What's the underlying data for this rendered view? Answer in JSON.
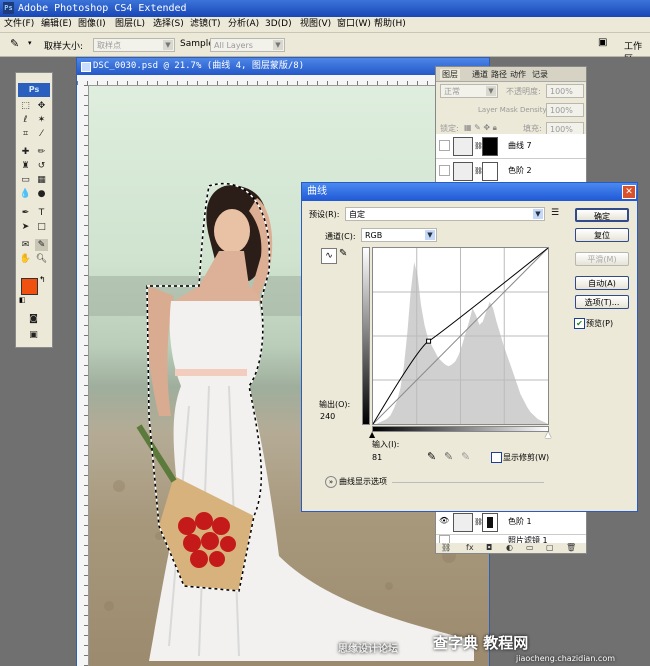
{
  "app": {
    "title": "Adobe Photoshop CS4 Extended",
    "logo_text": "Ps"
  },
  "menu": [
    "文件(F)",
    "编辑(E)",
    "图像(I)",
    "图层(L)",
    "选择(S)",
    "滤镜(T)",
    "分析(A)",
    "3D(D)",
    "视图(V)",
    "窗口(W)",
    "帮助(H)"
  ],
  "options": {
    "sample_size_label": "取样大小:",
    "sample_size_value": "取样点",
    "sample_label": "Sample:",
    "sample_value": "All Layers",
    "workspace_label": "工作区"
  },
  "toolbox": {
    "header": "Ps",
    "foreground_color": "#f05010",
    "background_color": "#ffffff"
  },
  "document": {
    "title": "DSC_0030.psd @ 21.7% (曲线 4, 图层蒙版/8)"
  },
  "layers_panel": {
    "tabs": [
      "图层",
      "通道",
      "路径",
      "动作",
      "记录"
    ],
    "blend_mode": "正常",
    "opacity_label": "不透明度:",
    "opacity_value": "100%",
    "mask_density_label": "Layer Mask Density",
    "mask_density_value": "100%",
    "lock_label": "锁定:",
    "fill_label": "填充:",
    "fill_value": "100%",
    "layers": [
      {
        "name": "曲线 7"
      },
      {
        "name": "色阶 2"
      },
      {
        "name": "色阶 1"
      },
      {
        "name": "照片滤镜 1"
      }
    ]
  },
  "curves": {
    "title": "曲线",
    "preset_label": "预设(R):",
    "preset_value": "自定",
    "channel_label": "通道(C):",
    "channel_value": "RGB",
    "output_label": "输出(O):",
    "output_value": "240",
    "input_label": "输入(I):",
    "input_value": "81",
    "show_clipping": "显示修剪(W)",
    "display_options": "曲线显示选项",
    "preview_label": "预览(P)",
    "preview_checked": true,
    "buttons": {
      "ok": "确定",
      "reset": "复位",
      "smooth": "平滑(M)",
      "auto": "自动(A)",
      "options": "选项(T)..."
    },
    "histogram": [
      0,
      0,
      1,
      2,
      3,
      5,
      9,
      14,
      22,
      35,
      55,
      80,
      98,
      90,
      72,
      60,
      52,
      48,
      44,
      40,
      38,
      36,
      35,
      36,
      38,
      42,
      48,
      55,
      62,
      70,
      66,
      60,
      62,
      68,
      74,
      70,
      62,
      55,
      48,
      42,
      36,
      30,
      24,
      18,
      14,
      10,
      7,
      5,
      3,
      2,
      1
    ],
    "curve_points": [
      [
        0,
        0
      ],
      [
        81,
        120
      ],
      [
        255,
        255
      ]
    ]
  },
  "watermark": {
    "line1": "思缘设计论坛",
    "line2": "查字典 教程网",
    "url": "jiaocheng.chazidian.com"
  }
}
